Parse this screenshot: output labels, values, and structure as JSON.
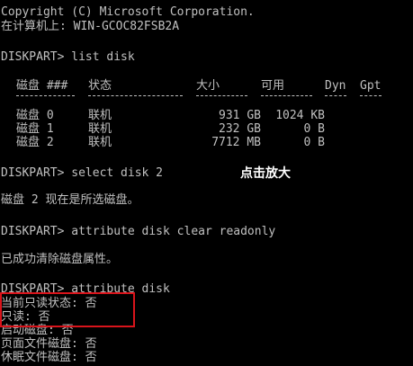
{
  "console": {
    "header": {
      "copyright": "Copyright (C) Microsoft Corporation.",
      "machine": "在计算机上: WIN-GCOC82FSB2A"
    },
    "cmd_list_disk": "DISKPART> list disk",
    "table": {
      "headers": [
        "磁盘 ###",
        "状态",
        "大小",
        "可用",
        "Dyn",
        "Gpt"
      ],
      "rows": [
        {
          "disk": "磁盘 0",
          "status": "联机",
          "size": "931 GB",
          "free": "1024 KB",
          "dyn": "",
          "gpt": ""
        },
        {
          "disk": "磁盘 1",
          "status": "联机",
          "size": "232 GB",
          "free": "0 B",
          "dyn": "",
          "gpt": ""
        },
        {
          "disk": "磁盘 2",
          "status": "联机",
          "size": "7712 MB",
          "free": "0 B",
          "dyn": "",
          "gpt": ""
        }
      ]
    },
    "cmd_select_disk": "DISKPART> select disk 2",
    "overlay_label": "点击放大",
    "msg_selected": "磁盘 2 现在是所选磁盘。",
    "cmd_clear_readonly": "DISKPART> attribute disk clear readonly",
    "msg_cleared": "已成功清除磁盘属性。",
    "cmd_attribute_disk": "DISKPART> attribute disk",
    "attr_lines": [
      "当前只读状态: 否",
      "只读: 否",
      "启动磁盘: 否",
      "页面文件磁盘: 否",
      "休眠文件磁盘: 否"
    ],
    "colors": {
      "background": "#000000",
      "text": "#c0c0c0",
      "overlay_text": "#ffffff",
      "highlight_border": "#d9141b"
    }
  }
}
